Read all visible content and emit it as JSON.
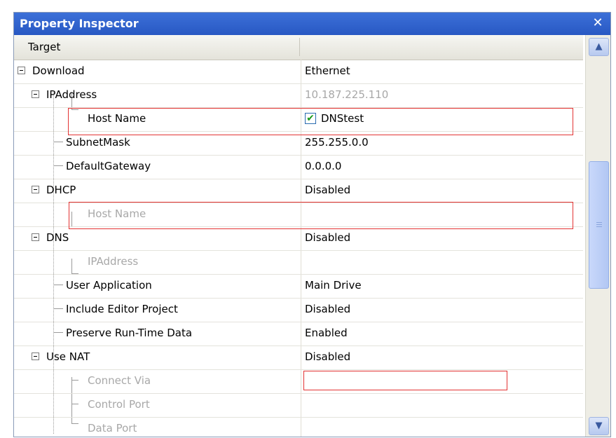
{
  "window": {
    "title": "Property Inspector",
    "close_glyph": "✕"
  },
  "header": {
    "col1": "Target",
    "col2": ""
  },
  "rows": [
    {
      "name": "Download",
      "value": "Ethernet"
    },
    {
      "name": "IPAddress",
      "value": "10.187.225.110"
    },
    {
      "name": "Host Name",
      "value": "DNStest",
      "checked": true
    },
    {
      "name": "SubnetMask",
      "value": "255.255.0.0"
    },
    {
      "name": "DefaultGateway",
      "value": "0.0.0.0"
    },
    {
      "name": "DHCP",
      "value": "Disabled"
    },
    {
      "name": "Host Name",
      "value": ""
    },
    {
      "name": "DNS",
      "value": "Disabled"
    },
    {
      "name": "IPAddress",
      "value": ""
    },
    {
      "name": "User Application",
      "value": "Main Drive"
    },
    {
      "name": "Include Editor Project",
      "value": "Disabled"
    },
    {
      "name": "Preserve Run-Time Data",
      "value": "Enabled"
    },
    {
      "name": "Use NAT",
      "value": "Disabled"
    },
    {
      "name": "Connect Via",
      "value": ""
    },
    {
      "name": "Control Port",
      "value": ""
    },
    {
      "name": "Data Port",
      "value": ""
    }
  ],
  "scrollbar": {
    "up_glyph": "▲",
    "down_glyph": "▼"
  },
  "colors": {
    "titlebar": "#2e5fc8",
    "highlight_box": "#e33333",
    "check": "#1b9a1b",
    "disabled_text": "#a8a8a8"
  }
}
